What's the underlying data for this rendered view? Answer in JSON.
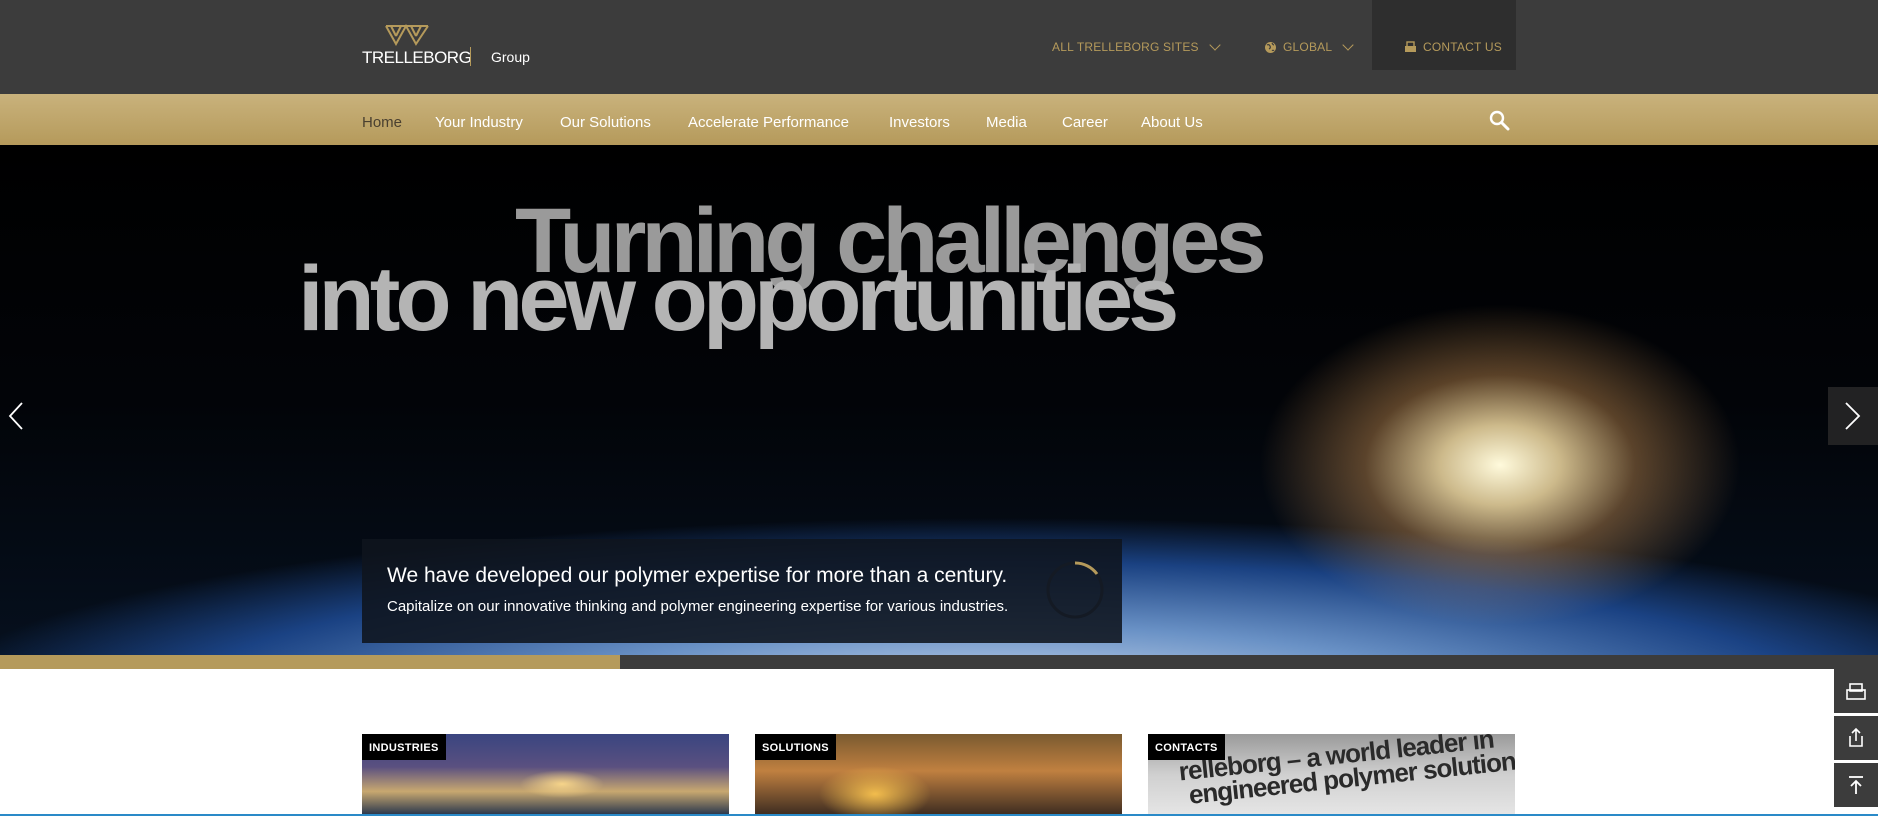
{
  "header": {
    "logo_text": "TRELLEBORG",
    "logo_group": "Group",
    "all_sites": "ALL TRELLEBORG SITES",
    "global": "GLOBAL",
    "contact": "CONTACT US"
  },
  "nav": {
    "items": [
      "Home",
      "Your Industry",
      "Our Solutions",
      "Accelerate Performance",
      "Investors",
      "Media",
      "Career",
      "About Us"
    ],
    "active": "Home"
  },
  "hero": {
    "line1": "Turning challenges",
    "line2": "into new opportunities",
    "caption_title": "We have developed our polymer expertise for more than a century.",
    "caption_sub": "Capitalize on our innovative thinking and polymer engineering expertise for various industries.",
    "progress": 0.33
  },
  "cards": [
    {
      "label": "INDUSTRIES"
    },
    {
      "label": "SOLUTIONS"
    },
    {
      "label": "CONTACTS",
      "image_text_1": "relleborg – a world leader in",
      "image_text_2": "engineered polymer solutions"
    }
  ],
  "icons": {
    "search": "search-icon",
    "globe": "globe-icon",
    "contact": "contact-icon",
    "prev": "chevron-left-icon",
    "next": "chevron-right-icon",
    "side_tools": [
      "contact-icon",
      "share-icon",
      "back-to-top-icon"
    ]
  },
  "colors": {
    "gold": "#b59a5b",
    "dark": "#3c3c3c",
    "darker": "#2e2e2e"
  }
}
